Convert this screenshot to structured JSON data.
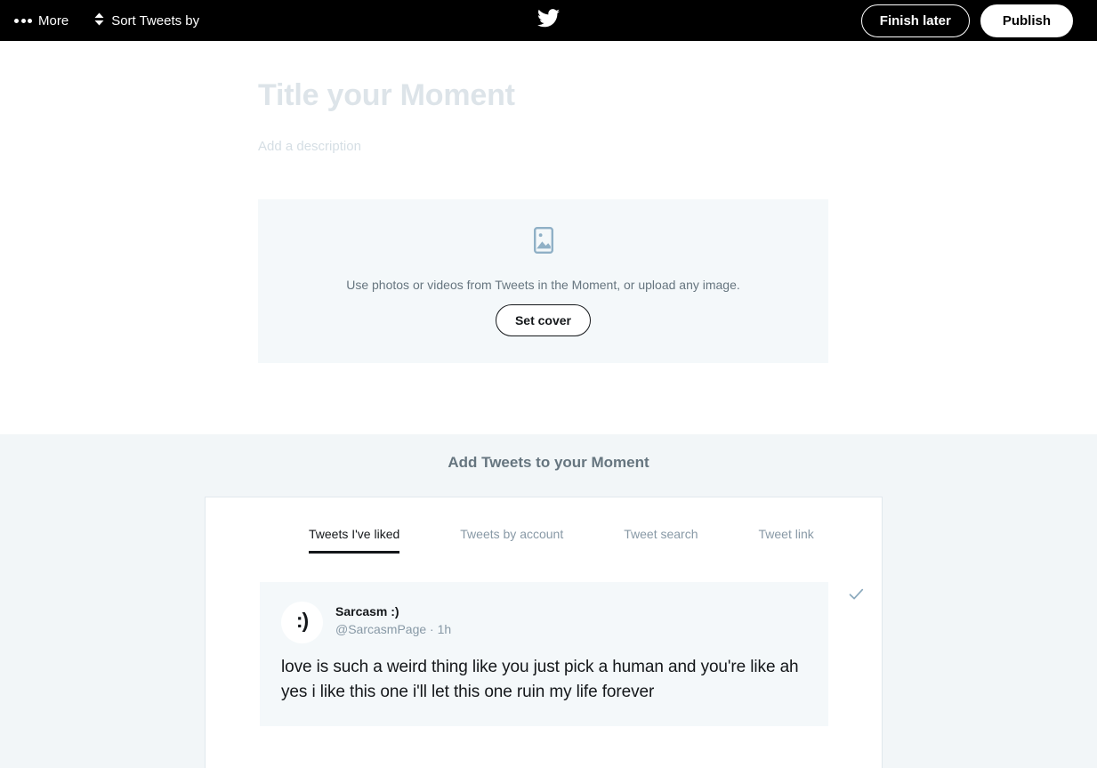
{
  "topbar": {
    "more_label": "More",
    "more_icon": "ellipsis-icon",
    "sort_label": "Sort Tweets by",
    "sort_icon": "sort-updown-icon",
    "logo_icon": "twitter-bird-icon",
    "finish_later_label": "Finish later",
    "publish_label": "Publish",
    "background": "#000000"
  },
  "composer": {
    "title_placeholder": "Title your Moment",
    "description_placeholder": "Add a description",
    "cover": {
      "icon": "photo-placeholder-icon",
      "hint": "Use photos or videos from Tweets in the Moment, or upload any image.",
      "button_label": "Set cover",
      "panel_color": "#f4f8fa"
    }
  },
  "add_section": {
    "heading": "Add Tweets to your Moment",
    "background": "#f2f6f8",
    "tabs": [
      {
        "label": "Tweets I've liked",
        "active": true
      },
      {
        "label": "Tweets by account",
        "active": false
      },
      {
        "label": "Tweet search",
        "active": false
      },
      {
        "label": "Tweet link",
        "active": false
      }
    ],
    "tweets": [
      {
        "avatar_glyph": ":)",
        "display_name": "Sarcasm :)",
        "handle": "@SarcasmPage",
        "separator": "·",
        "timestamp": "1h",
        "meta": "@SarcasmPage · 1h",
        "text": "love is such a weird thing like you just pick a human and you're like ah yes i like this one i'll let this one ruin my life forever",
        "select_icon": "checkmark-icon",
        "select_color": "#8aa9bd"
      }
    ]
  },
  "colors": {
    "placeholder_text": "#dde4e9",
    "muted_text": "#8899a6",
    "heading_text": "#66757f",
    "body_text": "#14171a",
    "panel_border": "#e1e8ed"
  }
}
